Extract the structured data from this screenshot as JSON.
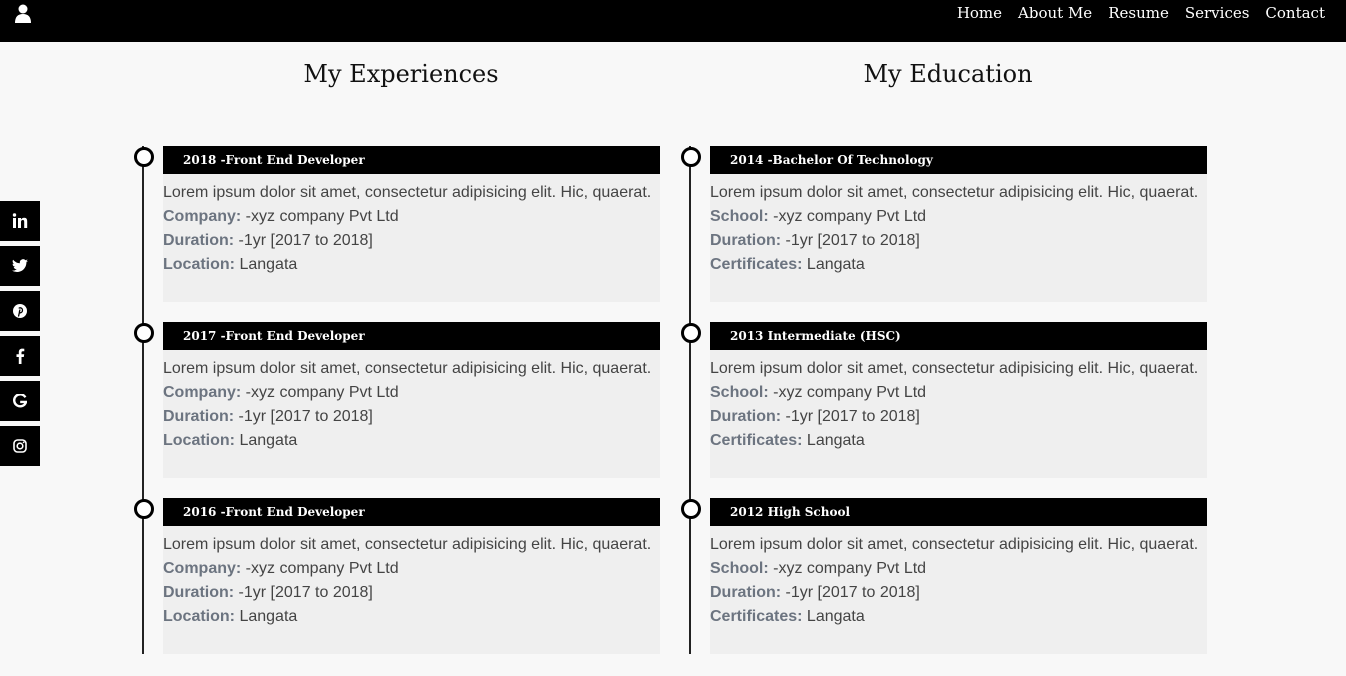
{
  "nav": {
    "items": [
      "Home",
      "About Me",
      "Resume",
      "Services",
      "Contact"
    ]
  },
  "social": [
    "linkedin-icon",
    "twitter-icon",
    "pinterest-icon",
    "facebook-icon",
    "google-icon",
    "instagram-icon"
  ],
  "experience": {
    "title": "My Experiences",
    "entries": [
      {
        "heading": "2018 -Front End Developer",
        "desc": "Lorem ipsum dolor sit amet, consectetur adipisicing elit. Hic, quaerat.",
        "l1": "Company:",
        "v1": " -xyz company Pvt Ltd",
        "l2": "Duration:",
        "v2": " -1yr [2017 to 2018]",
        "l3": "Location:",
        "v3": " Langata"
      },
      {
        "heading": "2017 -Front End Developer",
        "desc": "Lorem ipsum dolor sit amet, consectetur adipisicing elit. Hic, quaerat.",
        "l1": "Company:",
        "v1": " -xyz company Pvt Ltd",
        "l2": "Duration:",
        "v2": " -1yr [2017 to 2018]",
        "l3": "Location:",
        "v3": " Langata"
      },
      {
        "heading": "2016 -Front End Developer",
        "desc": "Lorem ipsum dolor sit amet, consectetur adipisicing elit. Hic, quaerat.",
        "l1": "Company:",
        "v1": " -xyz company Pvt Ltd",
        "l2": "Duration:",
        "v2": " -1yr [2017 to 2018]",
        "l3": "Location:",
        "v3": " Langata"
      }
    ]
  },
  "education": {
    "title": "My Education",
    "entries": [
      {
        "heading": "2014 -Bachelor Of Technology",
        "desc": "Lorem ipsum dolor sit amet, consectetur adipisicing elit. Hic, quaerat.",
        "l1": "School:",
        "v1": " -xyz company Pvt Ltd",
        "l2": "Duration:",
        "v2": " -1yr [2017 to 2018]",
        "l3": "Certificates:",
        "v3": " Langata"
      },
      {
        "heading": "2013 Intermediate (HSC)",
        "desc": "Lorem ipsum dolor sit amet, consectetur adipisicing elit. Hic, quaerat.",
        "l1": "School:",
        "v1": " -xyz company Pvt Ltd",
        "l2": "Duration:",
        "v2": " -1yr [2017 to 2018]",
        "l3": "Certificates:",
        "v3": " Langata"
      },
      {
        "heading": "2012 High School",
        "desc": "Lorem ipsum dolor sit amet, consectetur adipisicing elit. Hic, quaerat.",
        "l1": "School:",
        "v1": " -xyz company Pvt Ltd",
        "l2": "Duration:",
        "v2": " -1yr [2017 to 2018]",
        "l3": "Certificates:",
        "v3": " Langata"
      }
    ]
  }
}
